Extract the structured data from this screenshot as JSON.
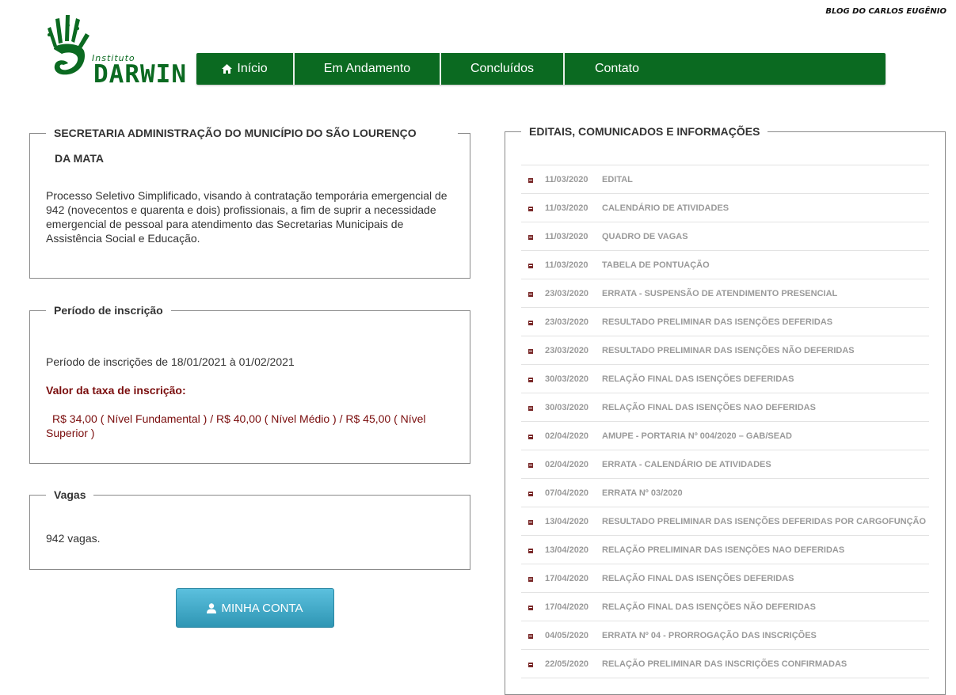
{
  "header": {
    "blog_link": "BLOG DO CARLOS EUGÊNIO",
    "logo_small": "Instituto",
    "logo_big": "DARWIN",
    "logo_color": "#0b6a21"
  },
  "nav": {
    "items": [
      {
        "label": "Início",
        "icon": "home-icon"
      },
      {
        "label": "Em Andamento"
      },
      {
        "label": "Concluídos"
      },
      {
        "label": "Contato"
      }
    ],
    "color": "#0b6a21"
  },
  "info": {
    "title_line1": "SECRETARIA ADMINISTRAÇÃO DO MUNICÍPIO DO SÃO LOURENÇO",
    "title_line2": "DA MATA",
    "description": "Processo Seletivo Simplificado, visando à contratação temporária emergencial de 942 (novecentos e quarenta e dois) profissionais, a fim de suprir a necessidade emergencial de pessoal para atendimento das Secretarias Municipais de Assistência Social e Educação."
  },
  "periodo": {
    "legend": "Período de inscrição",
    "text": "Período de inscrições de 18/01/2021 à 01/02/2021",
    "taxa_label": "Valor da taxa de inscrição:",
    "taxa_values": "R$ 34,00 ( Nível Fundamental ) / R$ 40,00 ( Nível Médio ) / R$ 45,00 ( Nível Superior )",
    "accent_color": "#7a0d0d"
  },
  "vagas": {
    "legend": "Vagas",
    "text": "942 vagas."
  },
  "account_button": {
    "label": "MINHA CONTA",
    "icon": "user-icon"
  },
  "editais": {
    "legend": "EDITAIS, COMUNICADOS E INFORMAÇÕES",
    "items": [
      {
        "date": "11/03/2020",
        "title": "EDITAL"
      },
      {
        "date": "11/03/2020",
        "title": "CALENDÁRIO DE ATIVIDADES"
      },
      {
        "date": "11/03/2020",
        "title": "QUADRO DE VAGAS"
      },
      {
        "date": "11/03/2020",
        "title": "TABELA DE PONTUAÇÃO"
      },
      {
        "date": "23/03/2020",
        "title": "ERRATA - SUSPENSÃO DE ATENDIMENTO PRESENCIAL"
      },
      {
        "date": "23/03/2020",
        "title": "RESULTADO PRELIMINAR DAS ISENÇÕES DEFERIDAS"
      },
      {
        "date": "23/03/2020",
        "title": "RESULTADO PRELIMINAR DAS ISENÇÕES NÃO DEFERIDAS"
      },
      {
        "date": "30/03/2020",
        "title": "RELAÇÃO FINAL DAS ISENÇÕES DEFERIDAS"
      },
      {
        "date": "30/03/2020",
        "title": "RELAÇÃO FINAL DAS ISENÇÕES NAO DEFERIDAS"
      },
      {
        "date": "02/04/2020",
        "title": "AMUPE - PORTARIA Nº 004/2020 – GAB/SEAD"
      },
      {
        "date": "02/04/2020",
        "title": "ERRATA - CALENDÁRIO DE ATIVIDADES"
      },
      {
        "date": "07/04/2020",
        "title": "ERRATA Nº 03/2020"
      },
      {
        "date": "13/04/2020",
        "title": "RESULTADO PRELIMINAR DAS ISENÇÕES DEFERIDAS POR CARGOFUNÇÃO"
      },
      {
        "date": "13/04/2020",
        "title": "RELAÇÃO PRELIMINAR DAS ISENÇÕES NAO DEFERIDAS"
      },
      {
        "date": "17/04/2020",
        "title": "RELAÇÃO FINAL DAS ISENÇÕES DEFERIDAS"
      },
      {
        "date": "17/04/2020",
        "title": "RELAÇÃO FINAL DAS ISENÇÕES NÃO DEFERIDAS"
      },
      {
        "date": "04/05/2020",
        "title": "ERRATA Nº 04 - PRORROGAÇÃO DAS INSCRIÇÕES"
      },
      {
        "date": "22/05/2020",
        "title": "RELAÇÃO PRELIMINAR DAS INSCRIÇÕES CONFIRMADAS"
      }
    ]
  }
}
